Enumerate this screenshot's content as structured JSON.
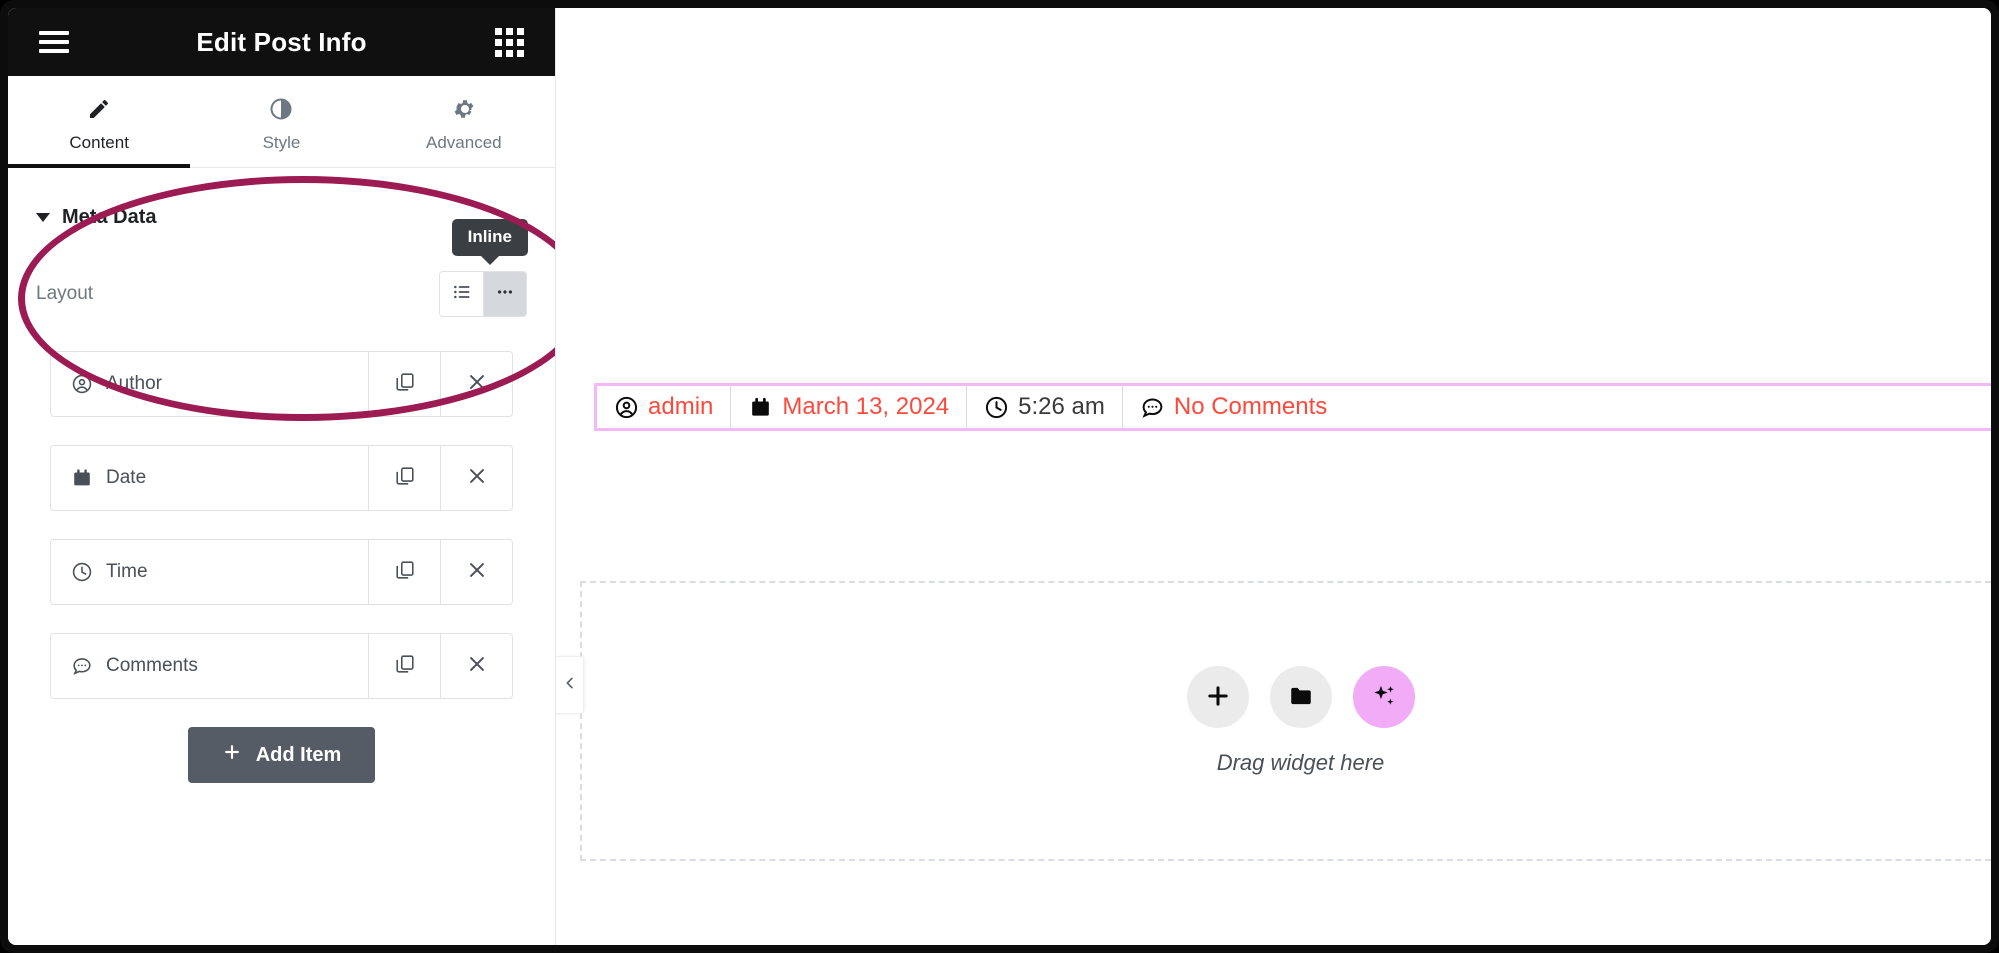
{
  "panel": {
    "header": {
      "title": "Edit Post Info",
      "menu_icon": "hamburger-menu-icon",
      "grid_icon": "app-grid-icon"
    },
    "tabs": [
      {
        "label": "Content",
        "icon": "pencil-icon",
        "active": true
      },
      {
        "label": "Style",
        "icon": "contrast-icon",
        "active": false
      },
      {
        "label": "Advanced",
        "icon": "gear-icon",
        "active": false
      }
    ],
    "section": {
      "title": "Meta Data",
      "collapse_icon": "caret-down-icon"
    },
    "layout_control": {
      "label": "Layout",
      "tooltip": "Inline",
      "options": [
        {
          "value": "stacked",
          "icon": "list-icon",
          "selected": false
        },
        {
          "value": "inline",
          "icon": "dots-icon",
          "selected": true
        }
      ]
    },
    "repeater": {
      "items": [
        {
          "label": "Author",
          "icon": "user-circle-icon"
        },
        {
          "label": "Date",
          "icon": "calendar-icon"
        },
        {
          "label": "Time",
          "icon": "clock-icon"
        },
        {
          "label": "Comments",
          "icon": "comment-icon"
        }
      ],
      "duplicate_icon": "copy-icon",
      "remove_icon": "close-x-icon",
      "add_button": {
        "label": "Add Item",
        "icon": "plus-icon"
      }
    },
    "annotation": {
      "shape": "ellipse-highlight",
      "color": "#9b1b52"
    }
  },
  "canvas": {
    "collapse_handle_icon": "chevron-left-icon",
    "meta_widget": {
      "selection_color": "#f3b8f8",
      "items": [
        {
          "icon": "user-circle-icon",
          "text": "admin",
          "muted": false
        },
        {
          "icon": "calendar-icon",
          "text": "March 13, 2024",
          "muted": false
        },
        {
          "icon": "clock-icon",
          "text": "5:26 am",
          "muted": true
        },
        {
          "icon": "comment-icon",
          "text": "No Comments",
          "muted": false
        }
      ],
      "link_color": "#fb4a3c"
    },
    "dropzone": {
      "label": "Drag widget here",
      "buttons": [
        {
          "name": "add-widget-button",
          "icon": "plus-icon",
          "accent": false
        },
        {
          "name": "add-template-button",
          "icon": "folder-icon",
          "accent": false
        },
        {
          "name": "ai-button",
          "icon": "sparkles-icon",
          "accent": true
        }
      ],
      "accent_color": "#f2abf7"
    }
  }
}
